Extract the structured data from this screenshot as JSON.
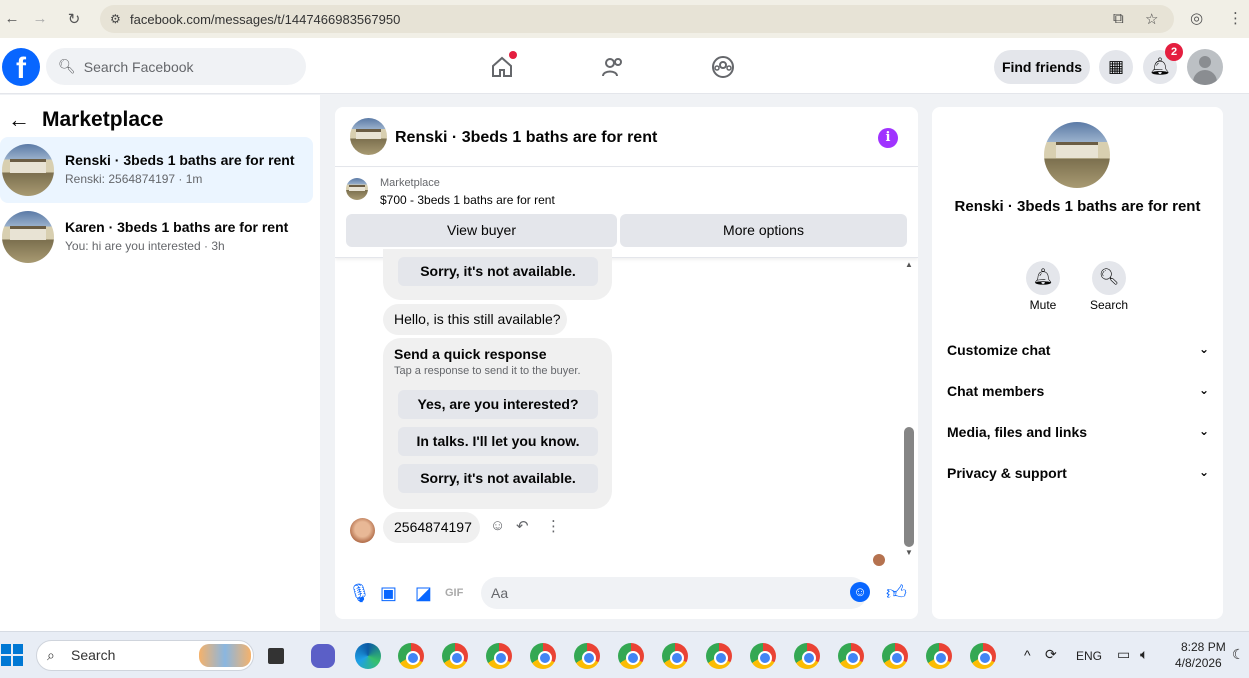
{
  "browser": {
    "url": "facebook.com/messages/t/1447466983567950"
  },
  "fb": {
    "logo": "f",
    "search_placeholder": "Search Facebook",
    "find_friends": "Find friends",
    "notif_count": "2"
  },
  "left": {
    "title": "Marketplace",
    "conversations": [
      {
        "name": "Renski · 3beds 1 baths are for rent",
        "sub": "Renski: 2564874197 · 1m"
      },
      {
        "name": "Karen · 3beds 1 baths are for rent",
        "sub": "You: hi are you interested · 3h"
      }
    ]
  },
  "chat": {
    "title": "Renski · 3beds 1 baths are for rent",
    "info_icon": "i",
    "marketplace_label": "Marketplace",
    "listing": "$700 - 3beds 1 baths are for rent",
    "view_buyer": "View buyer",
    "more_options": "More options",
    "top_quick_reply": "Sorry, it's not available.",
    "buyer_message": "Hello, is this still available?",
    "quick_title": "Send a quick response",
    "quick_sub": "Tap a response to send it to the buyer.",
    "quick_replies": [
      "Yes, are you interested?",
      "In talks. I'll let you know.",
      "Sorry, it's not available."
    ],
    "phone_message": "2564874197",
    "composer_placeholder": "Aa"
  },
  "right": {
    "name": "Renski · 3beds 1 baths are for rent",
    "mute": "Mute",
    "search": "Search",
    "sections": [
      "Customize chat",
      "Chat members",
      "Media, files and links",
      "Privacy & support"
    ]
  },
  "taskbar": {
    "search": "Search",
    "lang": "ENG",
    "time": "8:28 PM",
    "date": "4/8/2026"
  }
}
